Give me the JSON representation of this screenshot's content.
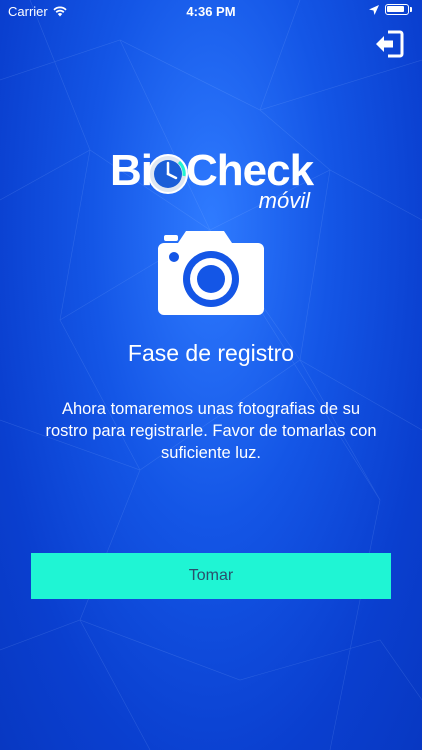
{
  "status_bar": {
    "carrier": "Carrier",
    "time": "4:36 PM",
    "icons": [
      "wifi-icon",
      "location-arrow-icon",
      "battery-icon"
    ]
  },
  "header": {
    "logout_icon": "exit-door-arrow-icon"
  },
  "logo": {
    "part1": "Bi",
    "part2": "Check",
    "subtitle": "móvil"
  },
  "main": {
    "icon": "camera-icon",
    "title": "Fase de registro",
    "description": "Ahora tomaremos unas fotografias de su rostro para registrarle. Favor de tomarlas con suficiente luz.",
    "button_label": "Tomar"
  },
  "colors": {
    "background": "#1456e6",
    "button": "#1ff5d4",
    "button_text": "#2b4f6c"
  }
}
